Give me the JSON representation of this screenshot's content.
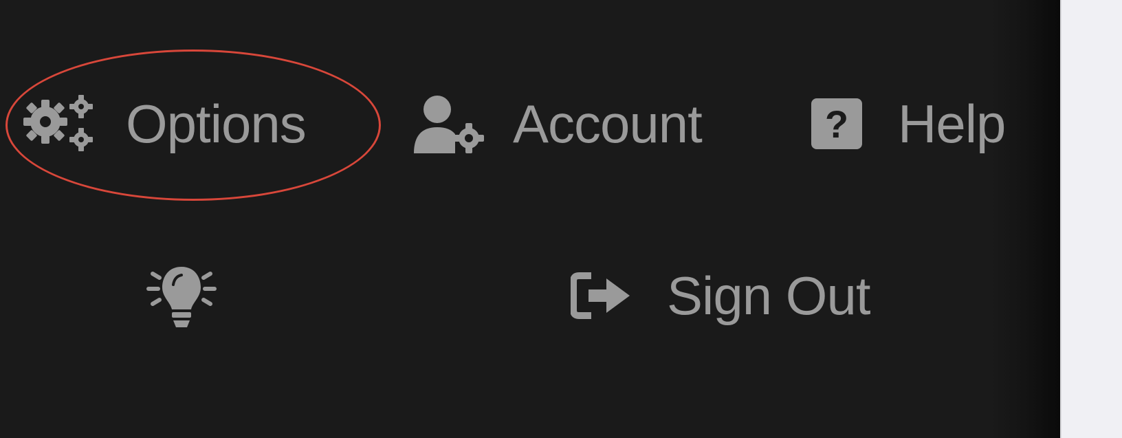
{
  "menu": {
    "items": [
      {
        "id": "options",
        "label": "Options",
        "icon": "gears-icon"
      },
      {
        "id": "account",
        "label": "Account",
        "icon": "user-gear-icon"
      },
      {
        "id": "help",
        "label": "Help",
        "icon": "question-square-icon"
      },
      {
        "id": "theme",
        "label": "",
        "icon": "lightbulb-icon"
      },
      {
        "id": "signout",
        "label": "Sign Out",
        "icon": "sign-out-icon"
      }
    ]
  },
  "colors": {
    "panel_bg": "#1a1a1a",
    "item_text": "#9a9a9a",
    "highlight_ring": "#d8473a",
    "side_strip": "#f0f0f4"
  }
}
